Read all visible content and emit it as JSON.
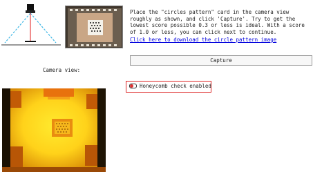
{
  "instructions": {
    "text": "Place the \"circles pattern\" card in the camera view roughly as shown, and click 'Capture'. Try to get the lowest score possible 0.3 or less is ideal.  With a score of 1.0 or less, you can click next to continue.",
    "download_link": "Click here to download the circle pattern image"
  },
  "capture_button": {
    "label": "Capture"
  },
  "camera_view": {
    "label": "Camera view:"
  },
  "honeycomb_check": {
    "label": "Honeycomb check enabled",
    "enabled": true
  },
  "colors": {
    "link": "#0000dd",
    "highlight": "#dd2222",
    "toggle_knob": "#dd3333",
    "laser_line": "#e21a1a",
    "camera_fov": "#40b8e6",
    "camera_glow": "#ffe629"
  },
  "icons": {
    "diagram": "camera-setup-diagram",
    "thumbnail": "pattern-placement-photo"
  }
}
